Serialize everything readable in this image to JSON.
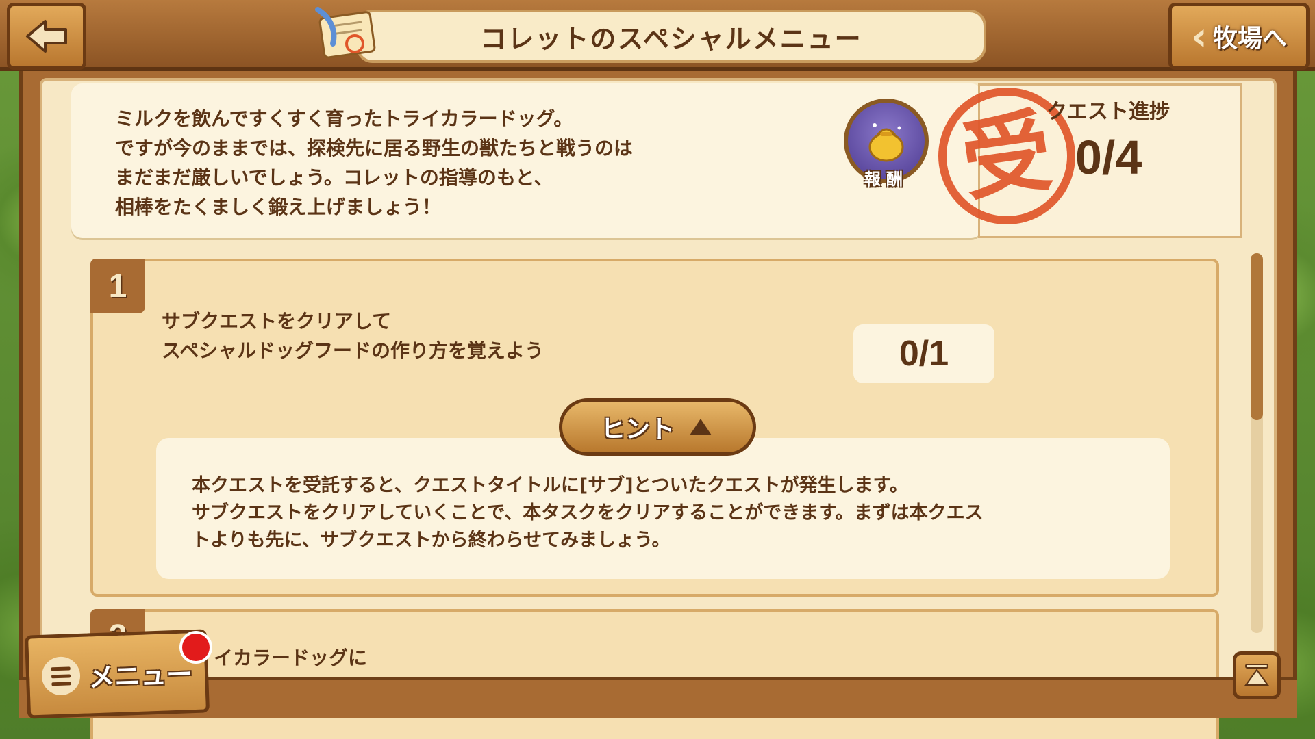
{
  "header": {
    "title": "コレットのスペシャルメニュー",
    "ranch_button_label": "牧場へ",
    "back_icon": "back-arrow-icon",
    "quest_icon": "quest-scroll-icon"
  },
  "description": {
    "lines": [
      "ミルクを飲んですくすく育ったトライカラードッグ。",
      "ですが今のままでは、探検先に居る野生の獣たちと戦うのは",
      "まだまだ厳しいでしょう。コレットの指導のもと、",
      "相棒をたくましく鍛え上げましょう！"
    ]
  },
  "reward": {
    "label": "報酬",
    "icon": "gold-pouch-icon"
  },
  "progress": {
    "stamp": "受",
    "title": "クエスト進捗",
    "value": "0/4"
  },
  "tasks": [
    {
      "number": "1",
      "text_lines": [
        "サブクエストをクリアして",
        "スペシャルドッグフードの作り方を覚えよう"
      ],
      "count": "0/1",
      "hint_label": "ヒント",
      "hint_lines": [
        "本クエストを受託すると、クエストタイトルに[サブ]とついたクエストが発生します。",
        "サブクエストをクリアしていくことで、本タスクをクリアすることができます。まずは本クエス",
        "トよりも先に、サブクエストから終わらせてみましょう。"
      ]
    },
    {
      "number": "2",
      "text_partial": "イカラードッグに"
    }
  ],
  "menu": {
    "label": "メニュー"
  },
  "colors": {
    "wood": "#a86b33",
    "paper": "#f7e8c5",
    "text": "#5b3416",
    "stamp": "#e0562a",
    "notify": "#e21b1b"
  }
}
